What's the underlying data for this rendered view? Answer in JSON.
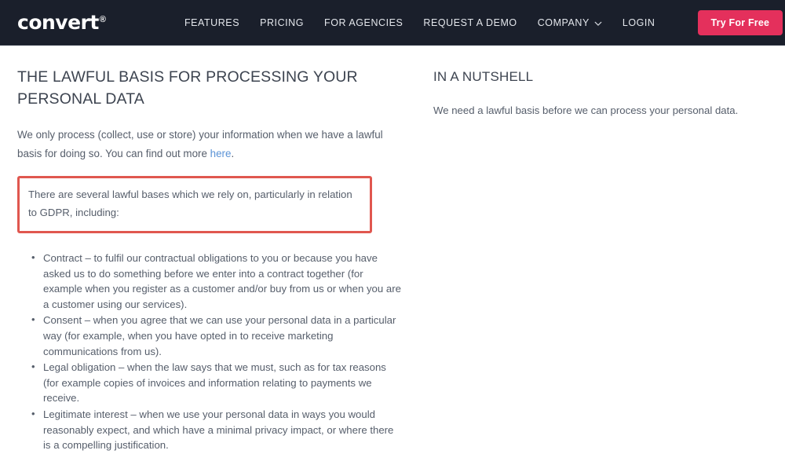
{
  "header": {
    "logo": {
      "text": "convert",
      "trademark": "®"
    },
    "nav_items": [
      {
        "label": "FEATURES",
        "name": "nav-link-features",
        "has_chevron": false
      },
      {
        "label": "PRICING",
        "name": "nav-link-pricing",
        "has_chevron": false
      },
      {
        "label": "FOR AGENCIES",
        "name": "nav-link-for-agencies",
        "has_chevron": false
      },
      {
        "label": "REQUEST A DEMO",
        "name": "nav-link-request-a-demo",
        "has_chevron": false
      },
      {
        "label": "COMPANY",
        "name": "nav-link-company",
        "has_chevron": true
      },
      {
        "label": "LOGIN",
        "name": "nav-link-login",
        "has_chevron": false
      }
    ],
    "cta_label": "Try For Free",
    "colors": {
      "background": "#1a1f2b",
      "cta_background": "#e4305c",
      "nav_text": "#e4e7ec"
    },
    "chevron_icon": "chevron-down-icon"
  },
  "main": {
    "left": {
      "title": "THE LAWFUL BASIS FOR PROCESSING YOUR PERSONAL DATA",
      "intro_before_link": "We only process (collect, use or store) your information when we have a lawful basis for doing so. You can find out more ",
      "intro_link_text": "here",
      "intro_after_link": ".",
      "highlight": {
        "text": "There are several lawful bases which we rely on, particularly in relation to GDPR, including:",
        "border_color": "#e0574f"
      },
      "bullets": [
        "Contract – to fulfil our contractual obligations to you or because you have asked us to do something before we enter into a contract together (for example when you register as a customer and/or buy from us or when you are a customer using our services).",
        "Consent – when you agree that we can use your personal data in a particular way (for example, when you have opted in to receive marketing communications from us).",
        "Legal obligation – when the law says that we must, such as for tax reasons (for example copies of invoices and information relating to payments we receive.",
        "Legitimate interest – when we use your personal data in ways you would reasonably expect, and which have a minimal privacy impact, or where there is a compelling justification."
      ]
    },
    "right": {
      "title": "IN A NUTSHELL",
      "text": "We need a lawful basis before we can process your personal data."
    }
  }
}
